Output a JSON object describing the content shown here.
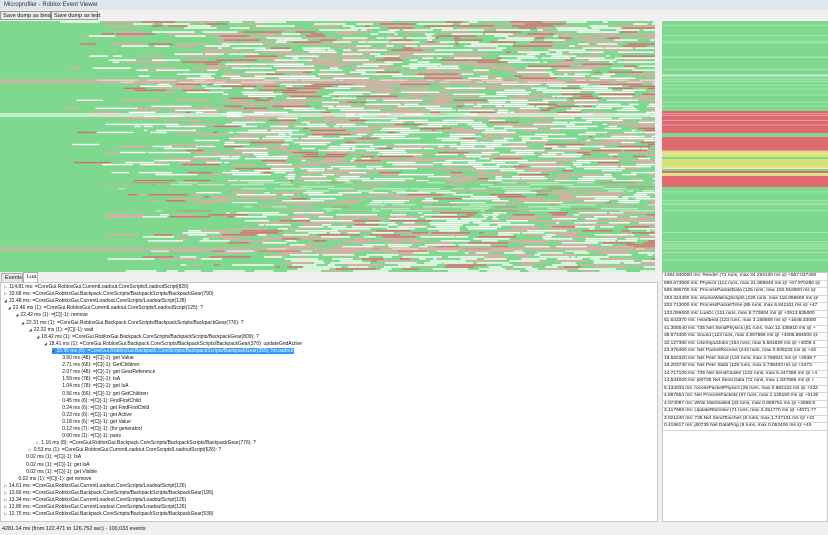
{
  "window": {
    "title": "Microprofiler - Roblox Event Viewer"
  },
  "toolbar": {
    "save_binary": "Save dump as binary",
    "save_text": "Save dump as text"
  },
  "tabs": [
    "Events",
    "Lua"
  ],
  "active_tab": "Lua",
  "colors": {
    "green": "#7ed88e",
    "red": "#e06a72",
    "lightred": "#eaa7ad",
    "white": "#ffffff",
    "olive": "#d8e27a",
    "selection": "#3399ff"
  },
  "tree": [
    {
      "exp": "closed",
      "text": "114.81 ms: =CoreGui.RobloxGui.CurrentLoadout.CoreScripts/LoadoutScript(826)"
    },
    {
      "exp": "closed",
      "text": "33.68 ms: =CoreGui.RobloxGui.Backpack.CoreScripts/BackpackScripts/BackpackGear(790)"
    },
    {
      "exp": "open",
      "text": "22.48 ms: =CoreGui.RobloxGui.CurrentLoadout.CoreScripts/LoadoutScript(128)"
    },
    {
      "exp": "open",
      "text": "22.46 ms (1): =CoreGui.RobloxGui.CurrentLoadout.CoreScripts/LoadoutScript(125): ?"
    },
    {
      "exp": "open",
      "text": "22.42 ms (1): =[C](-1): remove"
    },
    {
      "exp": "open",
      "text": "22.31 ms (1): =CoreGui.RobloxGui.Backpack.CoreScripts/BackpackScripts/BackpackGear(776): ?"
    },
    {
      "exp": "open",
      "text": "22.22 ms (1): =[C](-1): wait"
    },
    {
      "exp": "open",
      "text": "18.42 ms (1): =CoreGui.RobloxGui.Backpack.CoreScripts/BackpackScripts/BackpackGear(809): ?"
    },
    {
      "exp": "open",
      "text": "18.41 ms (1): =CoreGui.RobloxGui.Backpack.CoreScripts/BackpackScripts/BackpackGear(370): updateGridActive"
    },
    {
      "exp": "open",
      "text": "15.95 ms (6): =CoreGui.RobloxGui.Backpack.CoreScripts/BackpackScripts/BackpackGear(355): InLoadout",
      "selected": true
    },
    {
      "exp": "none",
      "text": "3.50 ms (48): =[C](-1): get Value"
    },
    {
      "exp": "none",
      "text": "2.71 ms (66): =[C](-1): GetChildren"
    },
    {
      "exp": "none",
      "text": "2.07 ms (48): =[C](-1): get GearReference"
    },
    {
      "exp": "none",
      "text": "1.59 ms (78): =[C](-1): IsA"
    },
    {
      "exp": "none",
      "text": "1.04 ms (78): =[C](-1): get IsA"
    },
    {
      "exp": "none",
      "text": "0.56 ms (66): =[C](-1): get GetChildren"
    },
    {
      "exp": "none",
      "text": "0.45 ms (6): =[C](-1): FindFirstChild"
    },
    {
      "exp": "none",
      "text": "0.24 ms (6): =[C](-1): get FindFirstChild"
    },
    {
      "exp": "none",
      "text": "0.23 ms (6): =[C](-1): get Active"
    },
    {
      "exp": "none",
      "text": "0.18 ms (6): =[C](-1): get Value"
    },
    {
      "exp": "none",
      "text": "0.12 ms (7): =[C](-1): (for generator)"
    },
    {
      "exp": "none",
      "text": "0.00 ms (1): =[C](-1): pairs"
    },
    {
      "exp": "closed",
      "text": "1.16 ms (8): =CoreGui.RobloxGui.Backpack.CoreScripts/BackpackScripts/BackpackGear(776): ?"
    },
    {
      "exp": "closed",
      "text": "0.53 ms (1): =CoreGui.RobloxGui.CurrentLoadout.CoreScripts/LoadoutScript(626): ?"
    },
    {
      "exp": "none",
      "text": "0.02 ms (1): =[C](-1): IsA"
    },
    {
      "exp": "none",
      "text": "0.02 ms (1): =[C](-1): get IsA"
    },
    {
      "exp": "none",
      "text": "0.02 ms (1): =[C](-1): get Visible"
    },
    {
      "exp": "none",
      "text": "0.02 ms (1): =[C](-1): get remove"
    },
    {
      "exp": "closed",
      "text": "14.61 ms: =CoreGui.RobloxGui.CurrentLoadout.CoreScripts/LoadoutScript(126)"
    },
    {
      "exp": "closed",
      "text": "13.66 ms: =CoreGui.RobloxGui.Backpack.CoreScripts/BackpackScripts/BackpackGear(195)"
    },
    {
      "exp": "closed",
      "text": "13.34 ms: =CoreGui.RobloxGui.CurrentLoadout.CoreScripts/LoadoutScript(126)"
    },
    {
      "exp": "closed",
      "text": "12.86 ms: =CoreGui.RobloxGui.CurrentLoadout.CoreScripts/LoadoutScript(126)"
    },
    {
      "exp": "closed",
      "text": "12.75 ms: =CoreGui.RobloxGui.Backpack.CoreScripts/BackpackScripts/BackpackGear(538)"
    }
  ],
  "stats": [
    "1484.940000 ms: Render (71 runs, max 34.294130 ms @ +557.037400",
    "899.673500 ms: Physics (112 runs, max 21.885840 ms @ +67.970280 @",
    "505.996700 ms: ProcessPacketData (125 runs, max 192.916900 ms @",
    "283.424400 ms: esumeWaitingScripts (226 runs, max 116.096500 ms @",
    "202.713000 ms: ProcessPacketTime (85 runs, max 9.841101 ms @ +47",
    "133.056600 ms: LuaGc (121 runs, max 8.773804 ms @ +2913.635000",
    "51.643370 ms: Heartbeat (123 runs, max 3.158569 ms @ +1648.33800",
    "41.305540 ms: 735 Net SendPhysics (81 runs, max 12.435910 ms @ +",
    "38.673400 ms: Sound (123 runs, max 2.067566 ms @ +4206.894000 @",
    "32.127380 ms: UserInputJobs (154 runs, max 5.561829 ms @ +4008.4",
    "23.376460 ms: Net PacketReceive (243 runs, max 0.839233 ms @ +16",
    "18.562320 ms: Net Peer Send (134 runs, max 3.768921 ms @ +2838.7",
    "18.203740 ms: Net Peer Stats (125 runs, max 3.738403 ms @ +2473.",
    "14.717100 ms: 735 Net SendCluster (122 runs, max 5.447388 ms @ +4",
    "14.534000 ms: j60735 Net Send Data (72 runs, max 1.937866 ms @ +",
    "6.134033 ms: rocessPacketPhysics (28 runs, max 0.862122 ms @ +232",
    "4.867554 ms: Net ProcessPackets (87 runs, max 1.129150 ms @ +2130",
    "4.074097 ms: Write Marshalled (33 runs, max 0.869751 ms @ +2898.9",
    "3.417969 ms: UpdateRbxView (71 runs, max 0.251770 ms @ +4071.77",
    "3.021240 ms: 735 Net SendTouches (8 runs, max 1.747131 ms @ +22",
    "0.419617 ms: j60735 Net DataPing (9 runs, max 0.053406 ms @ +45"
  ],
  "status": "4281.14 ms (from 122.471 to 126.752 sec) - 100,033 events"
}
